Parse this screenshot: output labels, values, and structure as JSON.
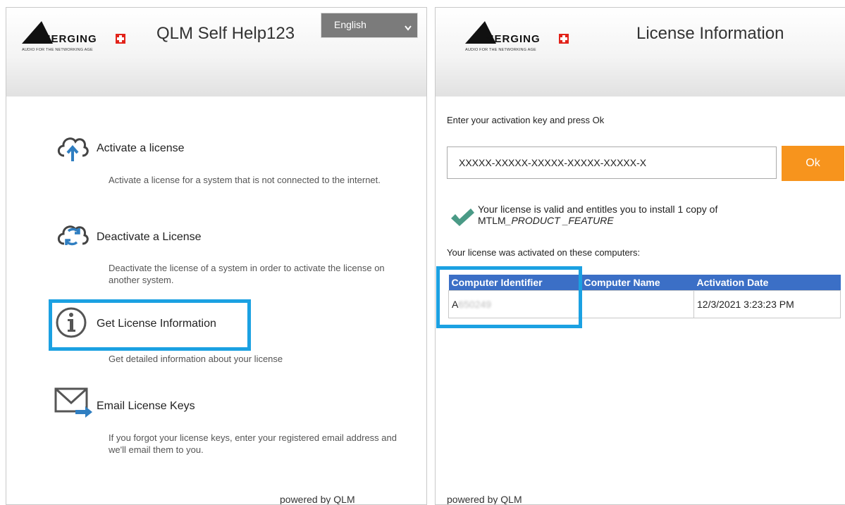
{
  "left_panel": {
    "logo_text": "MERGING",
    "logo_tagline": "AUDIO FOR THE NETWORKING AGE",
    "title": "QLM Self Help123",
    "language": "English",
    "items": [
      {
        "label": "Activate a license",
        "desc": "Activate a license for a system that is not connected to the internet.",
        "icon": "cloud-upload-icon"
      },
      {
        "label": "Deactivate a License",
        "desc": "Deactivate the license of a system in order to activate the license on another system.",
        "icon": "cloud-sync-icon"
      },
      {
        "label": "Get License Information",
        "desc": "Get detailed information about your license",
        "icon": "info-icon",
        "highlighted": true
      },
      {
        "label": "Email License Keys",
        "desc": "If you forgot your license keys, enter your registered email address and we'll email them to you.",
        "icon": "envelope-icon"
      }
    ],
    "powered_by": "powered by QLM"
  },
  "right_panel": {
    "logo_text": "MERGING",
    "logo_tagline": "AUDIO FOR THE NETWORKING AGE",
    "title": "License Information",
    "prompt": "Enter your activation key and press Ok",
    "activation_key": "XXXXX-XXXXX-XXXXX-XXXXX-XXXXX-X",
    "ok_label": "Ok",
    "valid_line1": "Your license is valid and entitles you to install 1 copy of",
    "valid_product_prefix": "MTLM",
    "valid_product": "_PRODUCT _FEATURE",
    "computers_heading": "Your license was activated on these computers:",
    "table": {
      "headers": [
        "Computer Identifier",
        "Computer Name",
        "Activation Date"
      ],
      "rows": [
        {
          "identifier_prefix": "A",
          "identifier_blurred": "650249",
          "name": "",
          "date": "12/3/2021 3:23:23 PM"
        }
      ]
    },
    "powered_by": "powered by QLM"
  },
  "colors": {
    "highlight": "#1ba1e2",
    "ok_button": "#f7941d",
    "table_header": "#3b6fc6",
    "check": "#4a9a86",
    "logo_red": "#e2231a"
  }
}
